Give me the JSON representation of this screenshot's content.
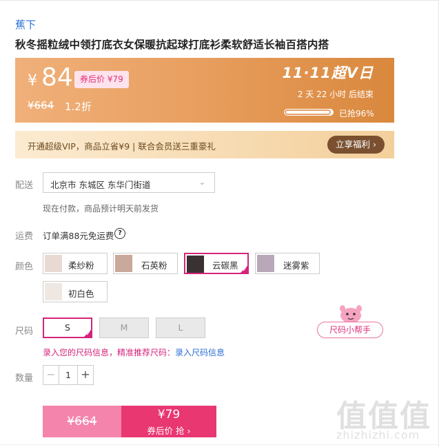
{
  "brand": "蕉下",
  "title": "秋冬摇粒绒中领打底衣女保暖抗起球打底衫柔软舒适长袖百搭内搭",
  "price_banner": {
    "currency": "¥",
    "price": "84",
    "coupon_price_tag": "券后价 ¥79",
    "original_price": "¥664",
    "discount": "1.2折",
    "event_logo": "11·11超V日",
    "countdown": "2 天 22 小时 后结束",
    "progress_percent": 96,
    "sold_text": "已抢96%"
  },
  "vip_bar": {
    "text": "开通超级VIP，商品立省¥9 | 联合会员送三重豪礼",
    "button": "立享福利 ›"
  },
  "delivery": {
    "label": "配送",
    "address": "北京市 东城区 东华门街道",
    "note": "现在付款，商品预计明天前发货"
  },
  "shipping": {
    "label": "运费",
    "text": "订单满88元免运费",
    "help_icon": "?"
  },
  "color": {
    "label": "颜色",
    "options": [
      {
        "name": "柔纱粉",
        "swatch": "#e8d9d3"
      },
      {
        "name": "石英粉",
        "swatch": "#c9a99a"
      },
      {
        "name": "云碳黑",
        "swatch": "#3a3132"
      },
      {
        "name": "迷雾紫",
        "swatch": "#b9a9b8"
      },
      {
        "name": "初白色",
        "swatch": "#efe7e1"
      }
    ],
    "selected": "云碳黑"
  },
  "size": {
    "label": "尺码",
    "options": [
      "S",
      "M",
      "L"
    ],
    "selected": "S",
    "helper": "尺码小帮手",
    "info_prefix": "录入您的尺码信息，精准推荐尺码：",
    "info_link": "录入尺码信息"
  },
  "quantity": {
    "label": "数量",
    "value": "1",
    "minus": "−",
    "plus": "+"
  },
  "buy": {
    "original": "¥664",
    "coupon_price": "¥79",
    "coupon_label": "券后价 抢 ›"
  },
  "watermark": {
    "chars": "值值值",
    "url": "zhizhizhi.com"
  },
  "colors": {
    "brand_blue": "#2c6fd6",
    "accent_pink": "#d4237a",
    "banner_orange": "#e9a061",
    "buy_pink": "#e93772"
  }
}
